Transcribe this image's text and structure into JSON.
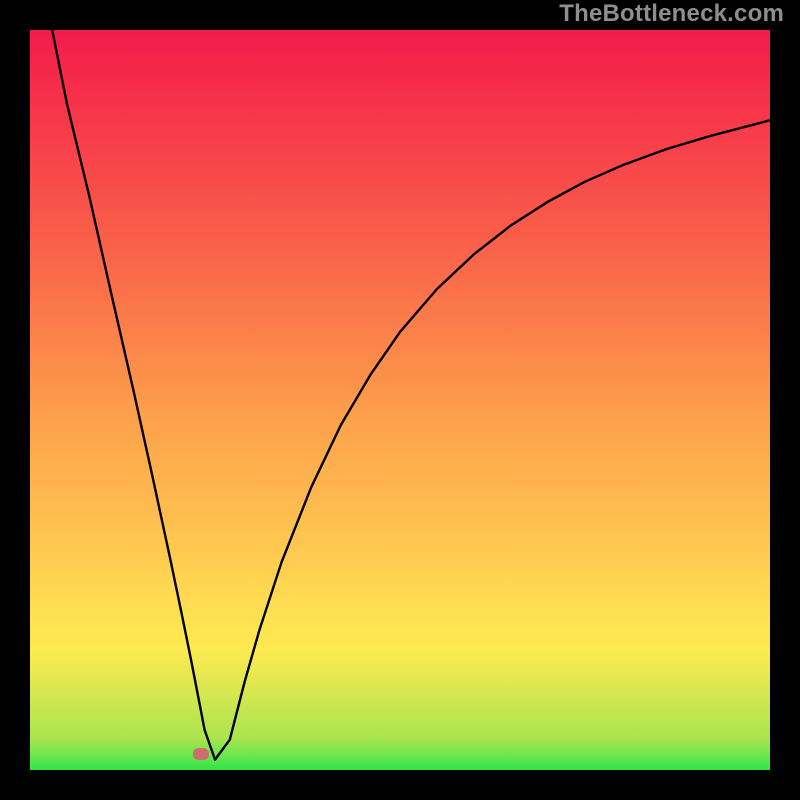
{
  "chart_data": {
    "type": "line",
    "title": "",
    "xlabel": "",
    "ylabel": "",
    "xlim": [
      0,
      100
    ],
    "ylim": [
      0,
      100
    ],
    "series": [
      {
        "name": "curve",
        "x": [
          3,
          5,
          8,
          11,
          14,
          16.5,
          19,
          20.5,
          21.7,
          22.5,
          23.6,
          25,
          27,
          29,
          31,
          34,
          38,
          42,
          46,
          50,
          55,
          60,
          65,
          70,
          75,
          80,
          86,
          92,
          100
        ],
        "values": [
          100,
          90,
          77.6,
          64.3,
          51.2,
          39.9,
          28.3,
          21.1,
          15.2,
          11.1,
          5.4,
          1.4,
          4.1,
          11.9,
          18.9,
          28.1,
          38.2,
          46.6,
          53.4,
          59.2,
          65.0,
          69.7,
          73.6,
          76.8,
          79.5,
          81.7,
          83.9,
          85.7,
          87.8
        ]
      }
    ],
    "marker": {
      "x": 23.1,
      "y": 2.2
    },
    "gradient": {
      "bottom_color": "#30e54c",
      "mid_color": "#fdea51",
      "top_color": "#f31b4b"
    }
  },
  "watermark": "TheBottleneck.com"
}
